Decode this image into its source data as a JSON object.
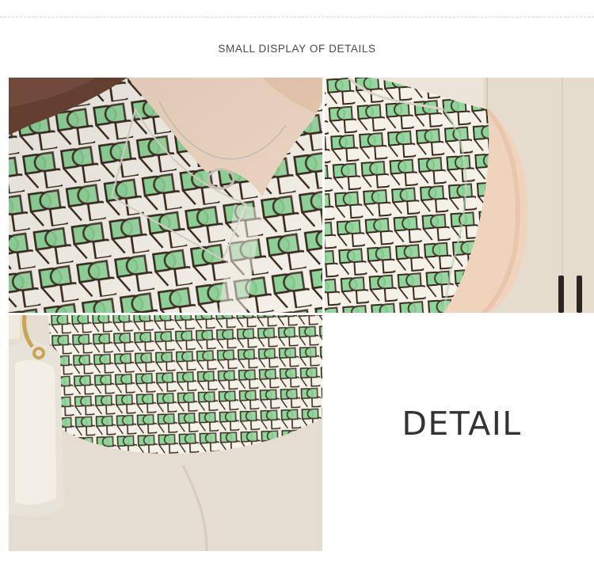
{
  "header": {
    "title": "SMALL DISPLAY OF DETAILS"
  },
  "detail_panel": {
    "label": "DETAIL"
  },
  "colors": {
    "print_green": "#8fd49a",
    "print_outline": "#3a2a1e",
    "print_base": "#f3f1e8",
    "skirt_beige": "#e4ddd0",
    "skin": "#efd7c2",
    "wall": "#ece4d8"
  },
  "photos": [
    {
      "subject": "collar-closeup"
    },
    {
      "subject": "shoulder-closeup"
    },
    {
      "subject": "waist-closeup"
    }
  ]
}
